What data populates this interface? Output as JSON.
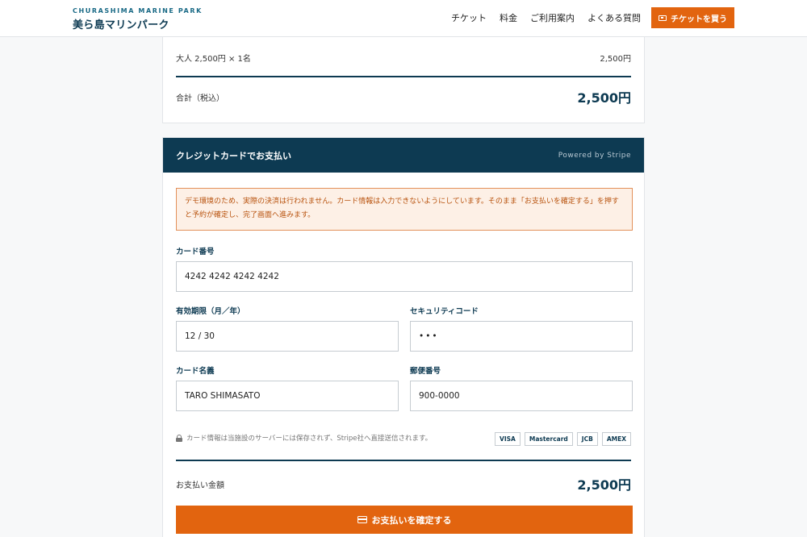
{
  "header": {
    "logo_en": "CHURASHIMA MARINE PARK",
    "logo_jp": "美ら島マリンパーク",
    "nav": [
      "チケット",
      "料金",
      "ご利用案内",
      "よくある質問"
    ],
    "cta_label": "チケットを買う"
  },
  "summary": {
    "item_label": "大人 2,500円 × 1名",
    "item_amount": "2,500円",
    "total_label": "合計（税込）",
    "total_value": "2,500円"
  },
  "payment": {
    "title": "クレジットカードでお支払い",
    "powered": "Powered by Stripe",
    "notice": "デモ環境のため、実際の決済は行われません。カード情報は入力できないようにしています。そのまま「お支払いを確定する」を押すと予約が確定し、完了画面へ進みます。",
    "card_number_label": "カード番号",
    "card_number_value": "4242 4242 4242 4242",
    "expiry_label": "有効期限（月／年）",
    "expiry_value": "12 / 30",
    "cvc_label": "セキュリティコード",
    "cvc_value": "•••",
    "name_label": "カード名義",
    "name_value": "TARO SHIMASATO",
    "zip_label": "郵便番号",
    "zip_value": "900-0000",
    "secure_text": "カード情報は当施設のサーバーには保存されず、Stripe社へ直接送信されます。",
    "brands": [
      "VISA",
      "Mastercard",
      "JCB",
      "AMEX"
    ],
    "total_label": "お支払い金額",
    "total_value": "2,500円",
    "confirm_label": "お支払いを確定する"
  },
  "colors": {
    "navy": "#0d3a52",
    "accent": "#e2640f",
    "notice_bg": "#fdf0e6",
    "notice_text": "#b8520d"
  }
}
